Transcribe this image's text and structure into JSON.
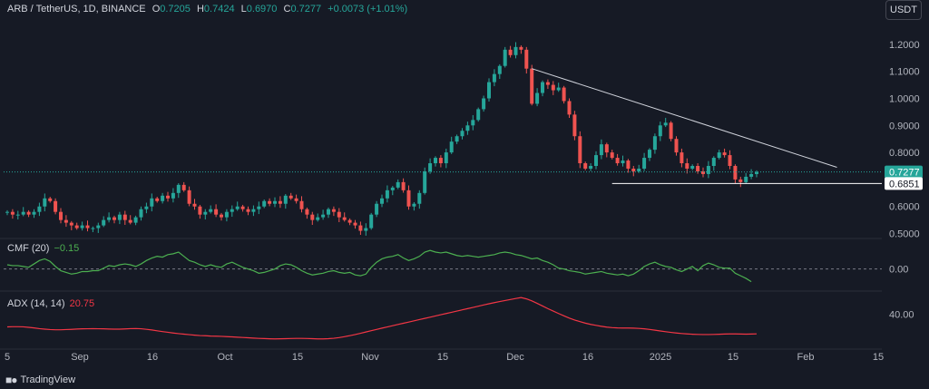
{
  "header": {
    "symbol": "ARB / TetherUS, 1D, BINANCE",
    "o_label": "O",
    "o_value": "0.7205",
    "h_label": "H",
    "h_value": "0.7424",
    "l_label": "L",
    "l_value": "0.6970",
    "c_label": "C",
    "c_value": "0.7277",
    "change": "+0.0073 (+1.01%)"
  },
  "currency_button": "USDT",
  "colors": {
    "up": "#26a69a",
    "down": "#ef5350",
    "background": "#161a25",
    "cmf": "#4caf50",
    "adx": "#f23645",
    "trendline": "#d1d4dc"
  },
  "indicators": {
    "cmf_label": "CMF (20)",
    "cmf_value": "−0.15",
    "adx_label": "ADX (14, 14)",
    "adx_value": "20.75"
  },
  "brand": "TradingView",
  "chart_data": {
    "type": "candlestick",
    "price_axis_ticks": [
      "1.2000",
      "1.1000",
      "1.0000",
      "0.9000",
      "0.8000",
      "0.7000",
      "0.6000",
      "0.5000"
    ],
    "price_ylim": [
      0.485,
      1.27
    ],
    "current_price_label": "0.7277",
    "support_label": "0.6851",
    "time_axis_labels": [
      "5",
      "Sep",
      "16",
      "Oct",
      "15",
      "Nov",
      "15",
      "Dec",
      "16",
      "2025",
      "15",
      "Feb",
      "15"
    ],
    "cmf_axis_ticks": [
      "0.00"
    ],
    "adx_axis_ticks": [
      "40.00"
    ],
    "close_series": [
      0.58,
      0.57,
      0.57,
      0.58,
      0.57,
      0.58,
      0.6,
      0.63,
      0.62,
      0.58,
      0.55,
      0.54,
      0.53,
      0.52,
      0.53,
      0.52,
      0.52,
      0.53,
      0.55,
      0.56,
      0.55,
      0.57,
      0.55,
      0.54,
      0.56,
      0.59,
      0.6,
      0.63,
      0.62,
      0.64,
      0.63,
      0.65,
      0.68,
      0.66,
      0.61,
      0.6,
      0.57,
      0.58,
      0.59,
      0.57,
      0.56,
      0.58,
      0.59,
      0.6,
      0.59,
      0.58,
      0.59,
      0.6,
      0.62,
      0.61,
      0.62,
      0.61,
      0.64,
      0.63,
      0.62,
      0.59,
      0.57,
      0.55,
      0.56,
      0.57,
      0.59,
      0.58,
      0.56,
      0.55,
      0.54,
      0.53,
      0.51,
      0.52,
      0.57,
      0.61,
      0.63,
      0.66,
      0.67,
      0.69,
      0.66,
      0.6,
      0.61,
      0.65,
      0.73,
      0.76,
      0.78,
      0.76,
      0.8,
      0.84,
      0.86,
      0.88,
      0.9,
      0.92,
      0.96,
      1.0,
      1.06,
      1.09,
      1.12,
      1.18,
      1.16,
      1.19,
      1.18,
      1.11,
      0.98,
      1.02,
      1.06,
      1.05,
      1.03,
      1.04,
      0.99,
      0.94,
      0.86,
      0.76,
      0.74,
      0.75,
      0.79,
      0.83,
      0.8,
      0.78,
      0.76,
      0.77,
      0.74,
      0.73,
      0.74,
      0.78,
      0.81,
      0.86,
      0.9,
      0.91,
      0.85,
      0.8,
      0.76,
      0.74,
      0.75,
      0.73,
      0.72,
      0.75,
      0.78,
      0.8,
      0.79,
      0.75,
      0.7,
      0.69,
      0.71,
      0.72,
      0.7277
    ],
    "open_price": 0.58,
    "trendline": {
      "from": [
        98,
        1.11
      ],
      "to": [
        155,
        0.745
      ]
    },
    "support_line": {
      "value": 0.6851,
      "from_index": 113
    },
    "cmf_series": [
      0.05,
      0.04,
      0.04,
      0.03,
      0.02,
      0.06,
      0.1,
      0.12,
      0.09,
      0.03,
      -0.02,
      -0.04,
      -0.06,
      -0.05,
      -0.03,
      -0.03,
      -0.02,
      -0.02,
      0.01,
      0.04,
      0.03,
      0.05,
      0.06,
      0.05,
      0.03,
      0.06,
      0.1,
      0.13,
      0.15,
      0.14,
      0.17,
      0.18,
      0.2,
      0.15,
      0.1,
      0.08,
      0.05,
      0.03,
      0.05,
      0.03,
      0.02,
      0.06,
      0.08,
      0.05,
      0.02,
      0.0,
      -0.02,
      -0.05,
      -0.04,
      -0.02,
      0.0,
      0.04,
      0.06,
      0.05,
      0.02,
      -0.02,
      -0.05,
      -0.07,
      -0.06,
      -0.05,
      -0.03,
      -0.02,
      -0.04,
      -0.05,
      -0.04,
      -0.07,
      -0.08,
      -0.06,
      0.02,
      0.08,
      0.12,
      0.14,
      0.15,
      0.17,
      0.13,
      0.1,
      0.12,
      0.15,
      0.2,
      0.22,
      0.2,
      0.19,
      0.2,
      0.18,
      0.16,
      0.15,
      0.16,
      0.15,
      0.14,
      0.15,
      0.16,
      0.17,
      0.19,
      0.2,
      0.19,
      0.17,
      0.16,
      0.14,
      0.12,
      0.13,
      0.1,
      0.08,
      0.05,
      0.01,
      0.0,
      -0.02,
      -0.03,
      -0.04,
      -0.06,
      -0.05,
      -0.04,
      -0.03,
      -0.05,
      -0.06,
      -0.07,
      -0.06,
      -0.08,
      -0.06,
      -0.02,
      0.03,
      0.06,
      0.08,
      0.05,
      0.03,
      0.02,
      -0.01,
      -0.03,
      0.0,
      0.03,
      -0.02,
      0.04,
      0.07,
      0.05,
      0.02,
      0.01,
      0.01,
      -0.05,
      -0.08,
      -0.11,
      -0.15
    ],
    "cmf_range": [
      -0.25,
      0.35
    ],
    "adx_series": [
      27.6,
      27.8,
      27.8,
      27.7,
      27.2,
      26.6,
      25.9,
      25.4,
      25.0,
      24.8,
      24.8,
      25.0,
      25.2,
      25.5,
      25.7,
      25.8,
      25.9,
      25.8,
      25.7,
      25.5,
      25.4,
      25.4,
      25.6,
      25.9,
      26.0,
      25.8,
      25.2,
      24.6,
      23.8,
      23.0,
      22.3,
      21.6,
      21.0,
      20.5,
      20.0,
      19.5,
      19.1,
      18.9,
      18.6,
      18.5,
      18.3,
      18.0,
      17.8,
      17.5,
      17.2,
      16.9,
      16.6,
      16.3,
      16.1,
      15.9,
      15.8,
      15.9,
      16.0,
      16.2,
      16.3,
      16.3,
      16.2,
      16.0,
      15.8,
      15.8,
      16.0,
      16.4,
      17.1,
      18.0,
      19.0,
      20.1,
      21.3,
      22.6,
      23.9,
      25.1,
      26.4,
      27.6,
      28.8,
      30.0,
      31.2,
      32.4,
      33.6,
      34.8,
      36.0,
      37.2,
      38.4,
      39.6,
      40.8,
      42.0,
      43.2,
      44.4,
      45.6,
      46.8,
      48.0,
      49.2,
      50.4,
      51.5,
      52.6,
      53.6,
      54.6,
      55.6,
      56.5,
      55.2,
      53.2,
      50.8,
      48.2,
      45.6,
      43.2,
      40.8,
      38.5,
      36.3,
      34.4,
      32.8,
      31.3,
      30.1,
      29.1,
      28.2,
      27.4,
      26.9,
      26.6,
      26.5,
      26.5,
      26.4,
      26.1,
      25.7,
      25.1,
      24.4,
      23.6,
      22.9,
      22.2,
      21.6,
      21.1,
      20.7,
      20.4,
      20.2,
      20.1,
      20.1,
      20.2,
      20.4,
      20.6,
      20.7,
      20.7,
      20.6,
      20.5,
      20.6,
      20.75
    ],
    "adx_range": [
      12,
      62
    ]
  }
}
